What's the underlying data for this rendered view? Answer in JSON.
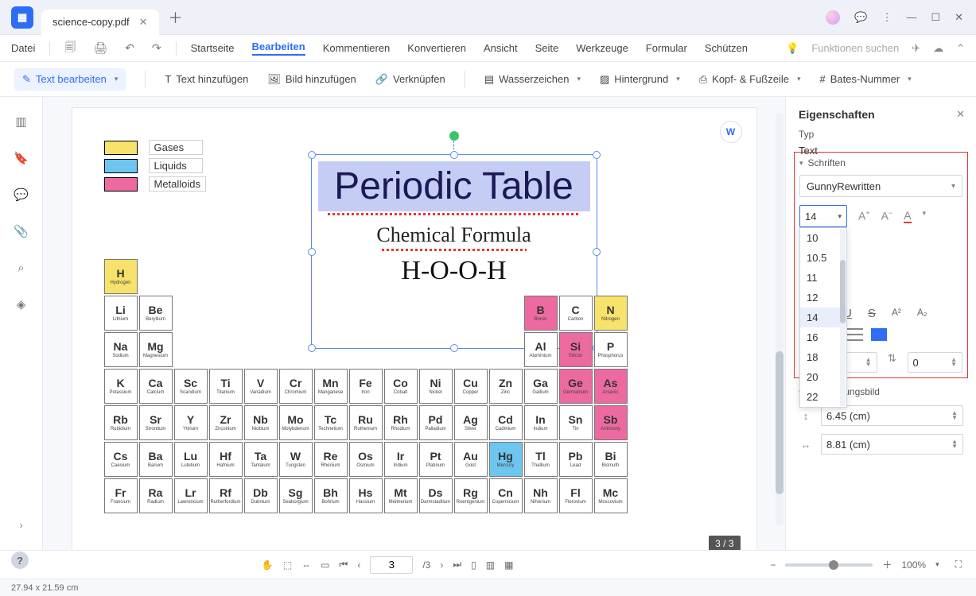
{
  "tab": {
    "title": "science-copy.pdf"
  },
  "menu": {
    "file": "Datei",
    "items": [
      "Startseite",
      "Bearbeiten",
      "Kommentieren",
      "Konvertieren",
      "Ansicht",
      "Seite",
      "Werkzeuge",
      "Formular",
      "Schützen"
    ],
    "active_index": 1,
    "search_placeholder": "Funktionen suchen"
  },
  "toolbar": {
    "edit_text": "Text bearbeiten",
    "add_text": "Text hinzufügen",
    "add_image": "Bild hinzufügen",
    "link": "Verknüpfen",
    "watermark": "Wasserzeichen",
    "background": "Hintergrund",
    "header_footer": "Kopf- & Fußzeile",
    "bates": "Bates-Nummer"
  },
  "document": {
    "legend": {
      "gases": "Gases",
      "liquids": "Liquids",
      "metalloids": "Metalloids"
    },
    "title_text": "Periodic Table",
    "subtitle1": "Chemical Formula",
    "subtitle2": "H-O-O-H",
    "convert_suffix": "W",
    "page_indicator": "3 / 3"
  },
  "elements": [
    {
      "sym": "H",
      "name": "Hydrogen",
      "r": 1,
      "c": 1,
      "cls": "c-y"
    },
    {
      "sym": "Li",
      "name": "Lithium",
      "r": 2,
      "c": 1
    },
    {
      "sym": "Be",
      "name": "Beryllium",
      "r": 2,
      "c": 2
    },
    {
      "sym": "Na",
      "name": "Sodium",
      "r": 3,
      "c": 1
    },
    {
      "sym": "Mg",
      "name": "Magnesium",
      "r": 3,
      "c": 2
    },
    {
      "sym": "K",
      "name": "Potassium",
      "r": 4,
      "c": 1
    },
    {
      "sym": "Ca",
      "name": "Calcium",
      "r": 4,
      "c": 2
    },
    {
      "sym": "Rb",
      "name": "Rubidium",
      "r": 5,
      "c": 1
    },
    {
      "sym": "Sr",
      "name": "Strontium",
      "r": 5,
      "c": 2
    },
    {
      "sym": "Cs",
      "name": "Caesium",
      "r": 6,
      "c": 1
    },
    {
      "sym": "Ba",
      "name": "Barium",
      "r": 6,
      "c": 2
    },
    {
      "sym": "Fr",
      "name": "Francium",
      "r": 7,
      "c": 1
    },
    {
      "sym": "Ra",
      "name": "Radium",
      "r": 7,
      "c": 2
    },
    {
      "sym": "Sc",
      "name": "Scandium",
      "r": 4,
      "c": 3
    },
    {
      "sym": "Ti",
      "name": "Titanium",
      "r": 4,
      "c": 4
    },
    {
      "sym": "V",
      "name": "Vanadium",
      "r": 4,
      "c": 5
    },
    {
      "sym": "Cr",
      "name": "Chromium",
      "r": 4,
      "c": 6
    },
    {
      "sym": "Mn",
      "name": "Manganese",
      "r": 4,
      "c": 7
    },
    {
      "sym": "Fe",
      "name": "Iron",
      "r": 4,
      "c": 8
    },
    {
      "sym": "Co",
      "name": "Cobalt",
      "r": 4,
      "c": 9
    },
    {
      "sym": "Ni",
      "name": "Nickel",
      "r": 4,
      "c": 10
    },
    {
      "sym": "Cu",
      "name": "Copper",
      "r": 4,
      "c": 11
    },
    {
      "sym": "Zn",
      "name": "Zinc",
      "r": 4,
      "c": 12
    },
    {
      "sym": "Y",
      "name": "Yttrium",
      "r": 5,
      "c": 3
    },
    {
      "sym": "Zr",
      "name": "Zirconium",
      "r": 5,
      "c": 4
    },
    {
      "sym": "Nb",
      "name": "Niobium",
      "r": 5,
      "c": 5
    },
    {
      "sym": "Mo",
      "name": "Molybdenum",
      "r": 5,
      "c": 6
    },
    {
      "sym": "Tc",
      "name": "Technetium",
      "r": 5,
      "c": 7
    },
    {
      "sym": "Ru",
      "name": "Ruthenium",
      "r": 5,
      "c": 8
    },
    {
      "sym": "Rh",
      "name": "Rhodium",
      "r": 5,
      "c": 9
    },
    {
      "sym": "Pd",
      "name": "Palladium",
      "r": 5,
      "c": 10
    },
    {
      "sym": "Ag",
      "name": "Silver",
      "r": 5,
      "c": 11
    },
    {
      "sym": "Cd",
      "name": "Cadmium",
      "r": 5,
      "c": 12
    },
    {
      "sym": "Lu",
      "name": "Lutetium",
      "r": 6,
      "c": 3
    },
    {
      "sym": "Hf",
      "name": "Hafnium",
      "r": 6,
      "c": 4
    },
    {
      "sym": "Ta",
      "name": "Tantalum",
      "r": 6,
      "c": 5
    },
    {
      "sym": "W",
      "name": "Tungsten",
      "r": 6,
      "c": 6
    },
    {
      "sym": "Re",
      "name": "Rhenium",
      "r": 6,
      "c": 7
    },
    {
      "sym": "Os",
      "name": "Osmium",
      "r": 6,
      "c": 8
    },
    {
      "sym": "Ir",
      "name": "Iridium",
      "r": 6,
      "c": 9
    },
    {
      "sym": "Pt",
      "name": "Platinum",
      "r": 6,
      "c": 10
    },
    {
      "sym": "Au",
      "name": "Gold",
      "r": 6,
      "c": 11
    },
    {
      "sym": "Hg",
      "name": "Mercury",
      "r": 6,
      "c": 12,
      "cls": "c-b"
    },
    {
      "sym": "Lr",
      "name": "Lawrencium",
      "r": 7,
      "c": 3
    },
    {
      "sym": "Rf",
      "name": "Rutherfordium",
      "r": 7,
      "c": 4
    },
    {
      "sym": "Db",
      "name": "Dubnium",
      "r": 7,
      "c": 5
    },
    {
      "sym": "Sg",
      "name": "Seaborgium",
      "r": 7,
      "c": 6
    },
    {
      "sym": "Bh",
      "name": "Bohrium",
      "r": 7,
      "c": 7
    },
    {
      "sym": "Hs",
      "name": "Hassium",
      "r": 7,
      "c": 8
    },
    {
      "sym": "Mt",
      "name": "Meitnerium",
      "r": 7,
      "c": 9
    },
    {
      "sym": "Ds",
      "name": "Darmstadtium",
      "r": 7,
      "c": 10
    },
    {
      "sym": "Rg",
      "name": "Roentgenium",
      "r": 7,
      "c": 11
    },
    {
      "sym": "Cn",
      "name": "Copernicium",
      "r": 7,
      "c": 12
    },
    {
      "sym": "B",
      "name": "Boron",
      "r": 2,
      "c": 13,
      "cls": "c-p"
    },
    {
      "sym": "C",
      "name": "Carbon",
      "r": 2,
      "c": 14
    },
    {
      "sym": "N",
      "name": "Nitrogen",
      "r": 2,
      "c": 15,
      "cls": "c-y"
    },
    {
      "sym": "Al",
      "name": "Aluminium",
      "r": 3,
      "c": 13
    },
    {
      "sym": "Si",
      "name": "Silicon",
      "r": 3,
      "c": 14,
      "cls": "c-p"
    },
    {
      "sym": "P",
      "name": "Phosphorus",
      "r": 3,
      "c": 15
    },
    {
      "sym": "Ga",
      "name": "Gallium",
      "r": 4,
      "c": 13
    },
    {
      "sym": "Ge",
      "name": "Germanium",
      "r": 4,
      "c": 14,
      "cls": "c-p"
    },
    {
      "sym": "As",
      "name": "Arsenic",
      "r": 4,
      "c": 15,
      "cls": "c-p"
    },
    {
      "sym": "In",
      "name": "Indium",
      "r": 5,
      "c": 13
    },
    {
      "sym": "Sn",
      "name": "Tin",
      "r": 5,
      "c": 14
    },
    {
      "sym": "Sb",
      "name": "Antimony",
      "r": 5,
      "c": 15,
      "cls": "c-p"
    },
    {
      "sym": "Tl",
      "name": "Thallium",
      "r": 6,
      "c": 13
    },
    {
      "sym": "Pb",
      "name": "Lead",
      "r": 6,
      "c": 14
    },
    {
      "sym": "Bi",
      "name": "Bismuth",
      "r": 6,
      "c": 15
    },
    {
      "sym": "Nh",
      "name": "Nihonium",
      "r": 7,
      "c": 13
    },
    {
      "sym": "Fl",
      "name": "Flerovium",
      "r": 7,
      "c": 14
    },
    {
      "sym": "Mc",
      "name": "Moscovium",
      "r": 7,
      "c": 15
    }
  ],
  "properties": {
    "panel_title": "Eigenschaften",
    "type_label": "Typ",
    "type_value": "Text",
    "fonts_section": "Schriften",
    "font_name": "GunnyRewritten",
    "font_size": "14",
    "font_size_options": [
      "10",
      "10.5",
      "11",
      "12",
      "14",
      "16",
      "18",
      "20",
      "22"
    ],
    "font_size_selected": "14",
    "spacing_left": "0",
    "spacing_right": "0",
    "appearance_section": "Erscheinungsbild",
    "width": "6.45 (cm)",
    "height": "8.81 (cm)"
  },
  "viewer": {
    "page_input": "3",
    "page_total": "/3",
    "zoom": "100%"
  },
  "status": {
    "dimensions": "27.94 x 21.59 cm"
  }
}
